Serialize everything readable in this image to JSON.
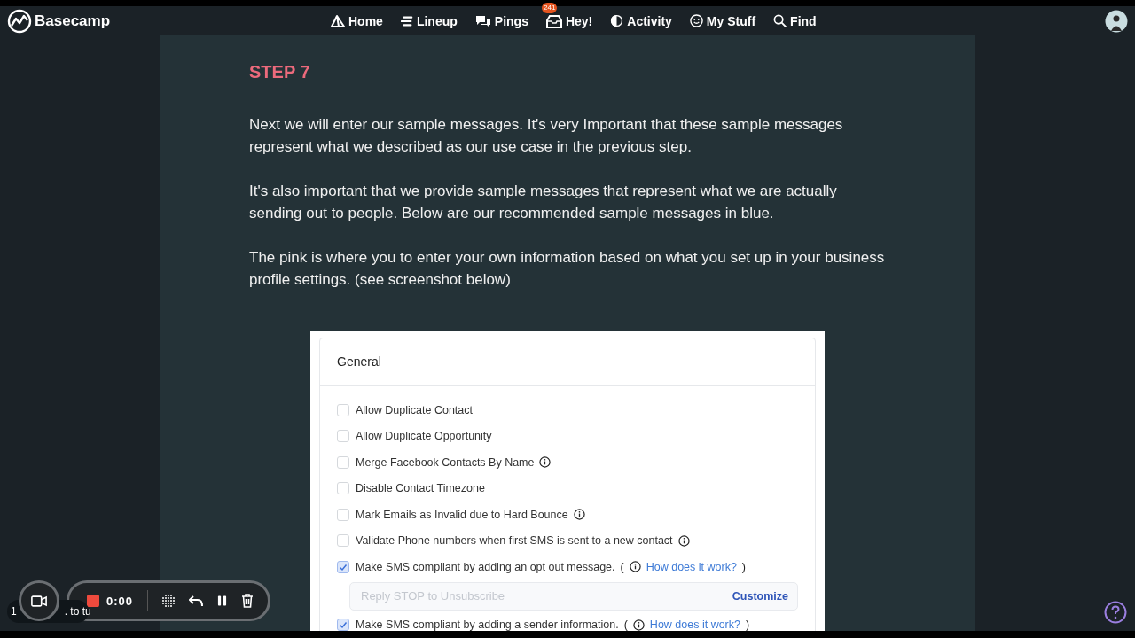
{
  "nav": {
    "brand": "Basecamp",
    "items": [
      {
        "label": "Home"
      },
      {
        "label": "Lineup"
      },
      {
        "label": "Pings"
      },
      {
        "label": "Hey!",
        "badge": "241"
      },
      {
        "label": "Activity"
      },
      {
        "label": "My Stuff"
      },
      {
        "label": "Find"
      }
    ]
  },
  "content": {
    "heading": "STEP 7",
    "paragraphs": [
      "Next we will enter our sample messages. It's very Important that these sample messages represent what we described as our use case in the previous step.",
      "It's also important that we provide sample messages that represent what we are actually sending out to people. Below are our recommended sample messages in blue.",
      "The pink is where you to enter your own information based on what you set up in your business profile settings. (see screenshot below)"
    ]
  },
  "screenshot": {
    "title": "General",
    "options": [
      {
        "kind": "checkbox",
        "label": "Allow Duplicate Contact",
        "checked": false,
        "info": false
      },
      {
        "kind": "checkbox",
        "label": "Allow Duplicate Opportunity",
        "checked": false,
        "info": false
      },
      {
        "kind": "checkbox",
        "label": "Merge Facebook Contacts By Name",
        "checked": false,
        "info": true
      },
      {
        "kind": "checkbox",
        "label": "Disable Contact Timezone",
        "checked": false,
        "info": false
      },
      {
        "kind": "checkbox",
        "label": "Mark Emails as Invalid due to Hard Bounce",
        "checked": false,
        "info": true
      },
      {
        "kind": "checkbox",
        "label": "Validate Phone numbers when first SMS is sent to a new contact",
        "checked": false,
        "info": true
      },
      {
        "kind": "checkbox",
        "label": "Make SMS compliant by adding an opt out message.",
        "checked": true,
        "info": true,
        "open": "(",
        "link": "How does it work?",
        "close": ")"
      },
      {
        "kind": "field",
        "placeholder": "Reply STOP to Unsubscribe",
        "action": "Customize"
      },
      {
        "kind": "checkbox",
        "label": "Make SMS compliant by adding a sender information.",
        "checked": true,
        "info": true,
        "open": "(",
        "link": "How does it work?",
        "close": ")"
      }
    ]
  },
  "recorder": {
    "time": "0:00",
    "tooltip_start": "1",
    "tooltip_end": ". to tu"
  }
}
